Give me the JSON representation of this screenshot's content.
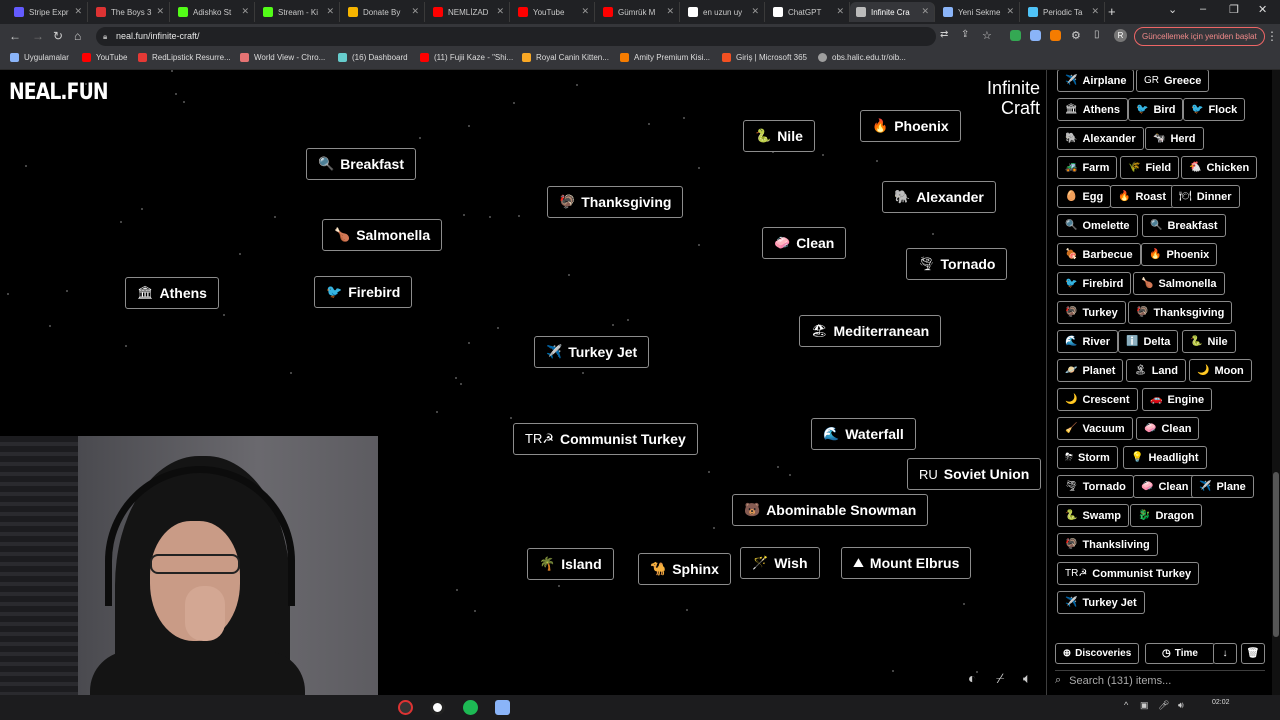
{
  "browser": {
    "tabs": [
      {
        "label": "Stripe Expr",
        "color": "#635bff"
      },
      {
        "label": "The Boys 3",
        "color": "#d33"
      },
      {
        "label": "Adishko St",
        "color": "#53fc18"
      },
      {
        "label": "Stream - Ki",
        "color": "#53fc18"
      },
      {
        "label": "Donate By",
        "color": "#f7b500"
      },
      {
        "label": "NEMLİZAD",
        "color": "#ff0000"
      },
      {
        "label": "YouTube",
        "color": "#ff0000"
      },
      {
        "label": "Gümrük M",
        "color": "#ff0000"
      },
      {
        "label": "en uzun uy",
        "color": "#ffffff"
      },
      {
        "label": "ChatGPT",
        "color": "#ffffff"
      },
      {
        "label": "Infinite Cra",
        "color": "#bbbbbb"
      },
      {
        "label": "Yeni Sekme",
        "color": "#8ab4f8"
      },
      {
        "label": "Periodic Ta",
        "color": "#4fc3f7"
      }
    ],
    "url": "neal.fun/infinite-craft/",
    "update_label": "Güncellemek için yeniden başlat",
    "profile_initial": "R",
    "bookmarks": [
      {
        "label": "Uygulamalar",
        "color": "#8ab4f8"
      },
      {
        "label": "YouTube",
        "color": "#ff0000"
      },
      {
        "label": "RedLipstick Resurre...",
        "color": "#e53935"
      },
      {
        "label": "World View - Chro...",
        "color": "#e57373"
      },
      {
        "label": "(16) Dashboard",
        "color": "#6cc"
      },
      {
        "label": "(11) Fujii Kaze - \"Shi...",
        "color": "#ff0000"
      },
      {
        "label": "Royal Canin Kitten...",
        "color": "#f9a825"
      },
      {
        "label": "Amity Premium Kisi...",
        "color": "#f57c00"
      },
      {
        "label": "Giriş | Microsoft 365",
        "color": "#f25022"
      },
      {
        "label": "obs.halic.edu.tr/oib...",
        "color": "#9e9e9e"
      }
    ]
  },
  "page": {
    "logo": "NEAL.FUN",
    "brand_line1": "Infinite",
    "brand_line2": "Craft"
  },
  "canvas_elements": [
    {
      "emoji": "🔍",
      "label": "Breakfast"
    },
    {
      "emoji": "🦃",
      "label": "Thanksgiving"
    },
    {
      "emoji": "🐍",
      "label": "Nile"
    },
    {
      "emoji": "🔥",
      "label": "Phoenix"
    },
    {
      "emoji": "🐘",
      "label": "Alexander"
    },
    {
      "emoji": "🍗",
      "label": "Salmonella"
    },
    {
      "emoji": "🧼",
      "label": "Clean"
    },
    {
      "emoji": "🌪",
      "label": "Tornado"
    },
    {
      "emoji": "🏛",
      "label": "Athens"
    },
    {
      "emoji": "🐦",
      "label": "Firebird"
    },
    {
      "emoji": "🏖",
      "label": "Mediterranean"
    },
    {
      "emoji": "✈️",
      "label": "Turkey Jet"
    },
    {
      "emoji": "TR☭",
      "label": "Communist Turkey"
    },
    {
      "emoji": "🌊",
      "label": "Waterfall"
    },
    {
      "emoji": "RU",
      "label": "Soviet Union"
    },
    {
      "emoji": "🐻",
      "label": "Abominable Snowman"
    },
    {
      "emoji": "🌴",
      "label": "Island"
    },
    {
      "emoji": "🐪",
      "label": "Sphinx"
    },
    {
      "emoji": "🪄",
      "label": "Wish"
    },
    {
      "emoji": "⛰",
      "label": "Mount Elbrus"
    }
  ],
  "sidebar": {
    "items": [
      {
        "emoji": "✈️",
        "label": "Airplane"
      },
      {
        "emoji": "GR",
        "label": "Greece"
      },
      {
        "emoji": "🏛",
        "label": "Athens"
      },
      {
        "emoji": "🐦",
        "label": "Bird"
      },
      {
        "emoji": "🐦",
        "label": "Flock"
      },
      {
        "emoji": "🐘",
        "label": "Alexander"
      },
      {
        "emoji": "🐄",
        "label": "Herd"
      },
      {
        "emoji": "🚜",
        "label": "Farm"
      },
      {
        "emoji": "🌾",
        "label": "Field"
      },
      {
        "emoji": "🐔",
        "label": "Chicken"
      },
      {
        "emoji": "🥚",
        "label": "Egg"
      },
      {
        "emoji": "🔥",
        "label": "Roast"
      },
      {
        "emoji": "🍽",
        "label": "Dinner"
      },
      {
        "emoji": "🔍",
        "label": "Omelette"
      },
      {
        "emoji": "🔍",
        "label": "Breakfast"
      },
      {
        "emoji": "🍖",
        "label": "Barbecue"
      },
      {
        "emoji": "🔥",
        "label": "Phoenix"
      },
      {
        "emoji": "🐦",
        "label": "Firebird"
      },
      {
        "emoji": "🍗",
        "label": "Salmonella"
      },
      {
        "emoji": "🦃",
        "label": "Turkey"
      },
      {
        "emoji": "🦃",
        "label": "Thanksgiving"
      },
      {
        "emoji": "🌊",
        "label": "River"
      },
      {
        "emoji": "ℹ️",
        "label": "Delta"
      },
      {
        "emoji": "🐍",
        "label": "Nile"
      },
      {
        "emoji": "🪐",
        "label": "Planet"
      },
      {
        "emoji": "🏝",
        "label": "Land"
      },
      {
        "emoji": "🌙",
        "label": "Moon"
      },
      {
        "emoji": "🌙",
        "label": "Crescent"
      },
      {
        "emoji": "🚗",
        "label": "Engine"
      },
      {
        "emoji": "🧹",
        "label": "Vacuum"
      },
      {
        "emoji": "🧼",
        "label": "Clean"
      },
      {
        "emoji": "⛈",
        "label": "Storm"
      },
      {
        "emoji": "💡",
        "label": "Headlight"
      },
      {
        "emoji": "🌪",
        "label": "Tornado"
      },
      {
        "emoji": "🧼",
        "label": "Clean"
      },
      {
        "emoji": "✈️",
        "label": "Plane"
      },
      {
        "emoji": "🐍",
        "label": "Swamp"
      },
      {
        "emoji": "🐉",
        "label": "Dragon"
      },
      {
        "emoji": "🦃",
        "label": "Thanksliving"
      },
      {
        "emoji": "TR☭",
        "label": "Communist Turkey"
      },
      {
        "emoji": "✈️",
        "label": "Turkey Jet"
      }
    ],
    "discoveries_label": "Discoveries",
    "time_label": "Time",
    "sort_icon": "↓",
    "search_placeholder": "Search (131) items..."
  },
  "taskbar": {
    "time": "02:02"
  },
  "colors": {
    "background": "#000000",
    "element_border": "#8c8c8c",
    "update_accent": "#f08a8a"
  }
}
